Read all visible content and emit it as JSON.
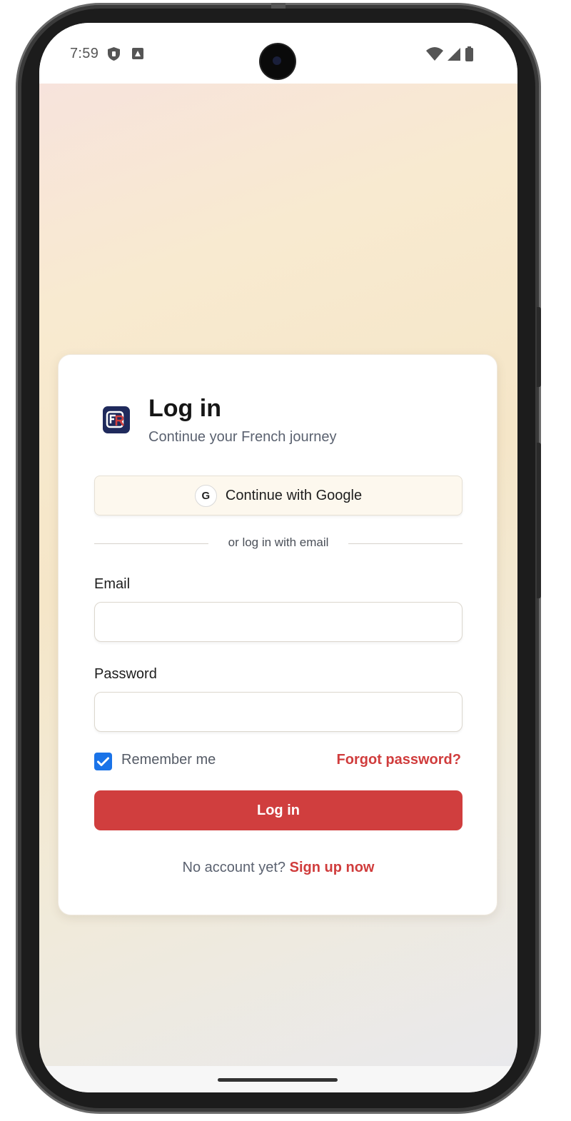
{
  "status_bar": {
    "time": "7:59"
  },
  "login": {
    "title": "Log in",
    "subtitle": "Continue your French journey",
    "google_button": {
      "icon_letter": "G",
      "label": "Continue with Google"
    },
    "divider_text": "or log in with email",
    "email": {
      "label": "Email",
      "value": "",
      "placeholder": ""
    },
    "password": {
      "label": "Password",
      "value": "",
      "placeholder": ""
    },
    "remember_me": {
      "label": "Remember me",
      "checked": true
    },
    "forgot_password_label": "Forgot password?",
    "submit_label": "Log in",
    "signup_prompt": "No account yet?",
    "signup_link": "Sign up now"
  },
  "colors": {
    "accent_red": "#d03e3e",
    "checkbox_blue": "#1a73e8",
    "logo_navy": "#1f2a5c"
  },
  "icons": {
    "logo": "app-logo-fr",
    "status_left": [
      "shield-icon",
      "app-notification-icon"
    ],
    "status_right": [
      "wifi-icon",
      "cell-signal-icon",
      "battery-icon"
    ]
  }
}
